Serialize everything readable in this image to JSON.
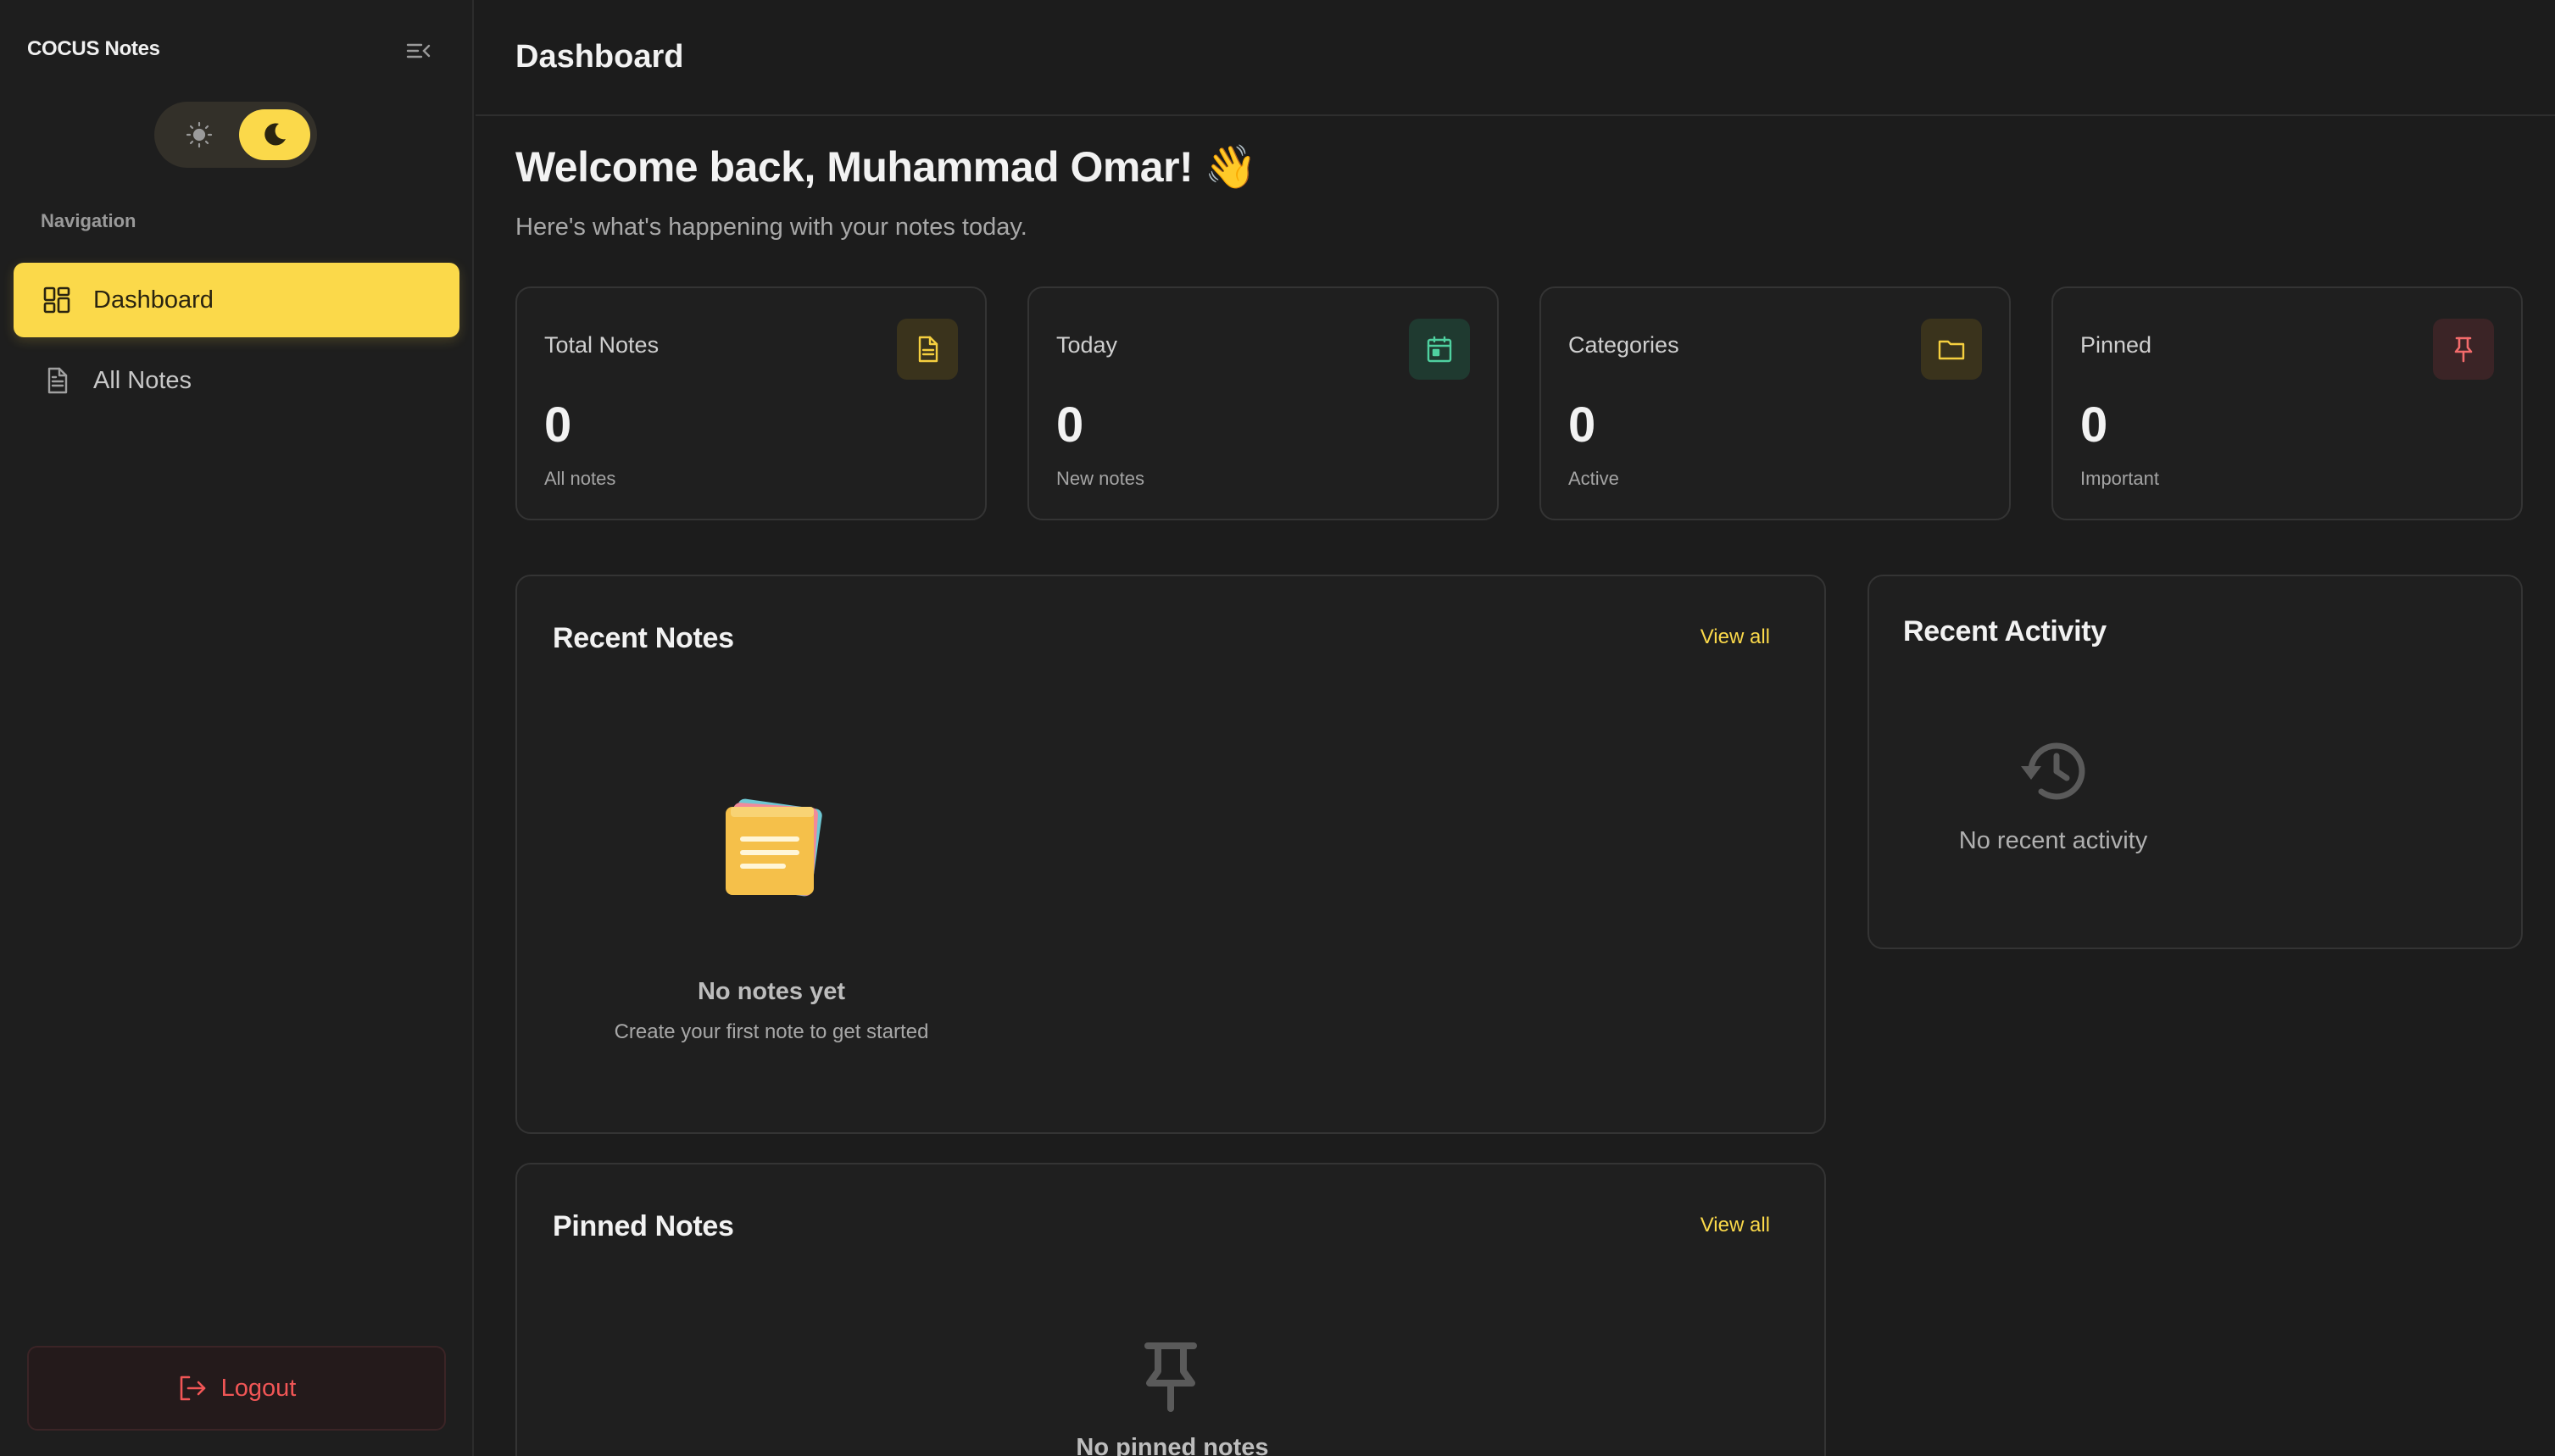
{
  "app": {
    "brand": "COCUS Notes"
  },
  "sidebar": {
    "nav_heading": "Navigation",
    "items": [
      {
        "label": "Dashboard",
        "icon": "dashboard-icon",
        "active": true
      },
      {
        "label": "All Notes",
        "icon": "document-icon",
        "active": false
      }
    ],
    "logout_label": "Logout"
  },
  "theme": {
    "options": [
      "light",
      "dark"
    ],
    "selected": "dark"
  },
  "header": {
    "title": "Dashboard"
  },
  "welcome": {
    "heading": "Welcome back, Muhammad Omar! 👋",
    "subtitle": "Here's what's happening with your notes today."
  },
  "stats": [
    {
      "label": "Total Notes",
      "value": "0",
      "caption": "All notes",
      "icon": "document-icon",
      "color": "#f5cf3f",
      "bg": "#3a331c"
    },
    {
      "label": "Today",
      "value": "0",
      "caption": "New notes",
      "icon": "calendar-icon",
      "color": "#4fd1a0",
      "bg": "#1f3a30"
    },
    {
      "label": "Categories",
      "value": "0",
      "caption": "Active",
      "icon": "folder-icon",
      "color": "#f5cf3f",
      "bg": "#3a331c"
    },
    {
      "label": "Pinned",
      "value": "0",
      "caption": "Important",
      "icon": "pin-icon",
      "color": "#f26b6b",
      "bg": "#3b2426"
    }
  ],
  "recent_notes": {
    "title": "Recent Notes",
    "view_all": "View all",
    "empty_title": "No notes yet",
    "empty_text": "Create your first note to get started"
  },
  "pinned_notes": {
    "title": "Pinned Notes",
    "view_all": "View all",
    "empty_title": "No pinned notes"
  },
  "recent_activity": {
    "title": "Recent Activity",
    "empty_text": "No recent activity"
  },
  "colors": {
    "accent": "#fbd94a",
    "background": "#1c1c1c",
    "danger": "#f15656"
  }
}
